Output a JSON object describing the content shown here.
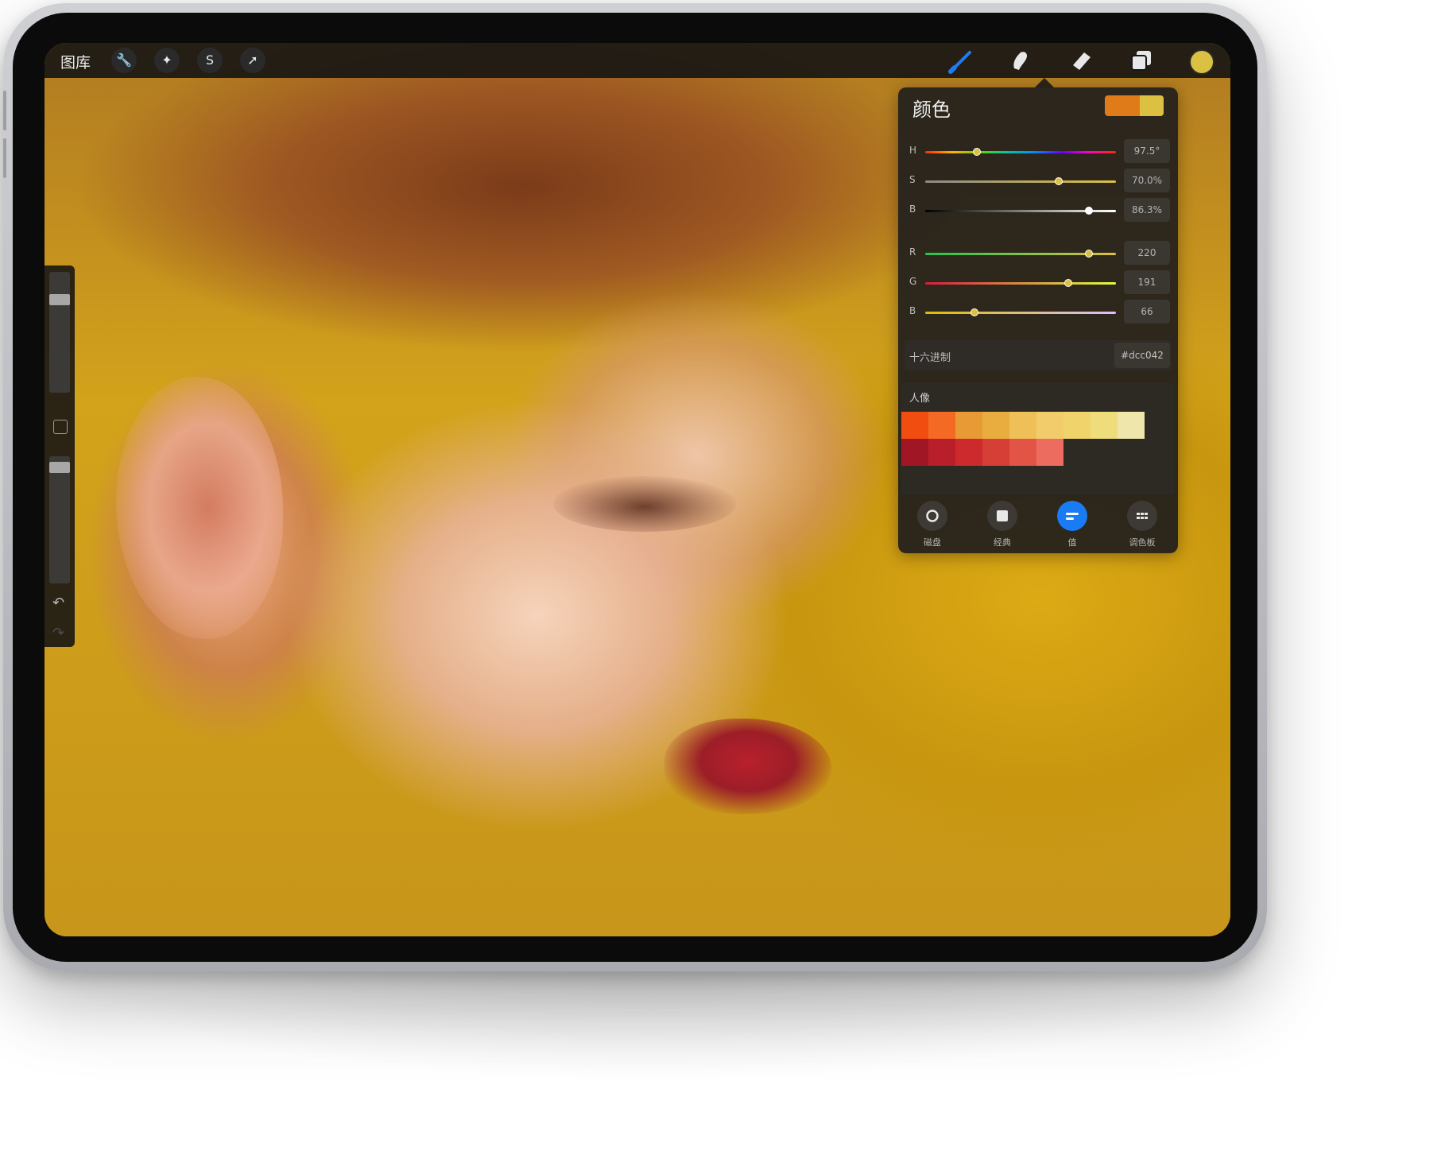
{
  "toolbar": {
    "gallery_label": "图库",
    "left_tools": [
      {
        "name": "actions",
        "icon": "wrench-icon",
        "glyph": "🔧"
      },
      {
        "name": "adjustments",
        "icon": "magic-wand-icon",
        "glyph": "✦"
      },
      {
        "name": "selection",
        "icon": "selection-s-icon",
        "glyph": "S"
      },
      {
        "name": "transform",
        "icon": "arrow-cursor-icon",
        "glyph": "➚"
      }
    ],
    "right_tools": [
      {
        "name": "brush",
        "icon": "brush-icon",
        "color": "#1f7cf0"
      },
      {
        "name": "smudge",
        "icon": "smudge-finger-icon",
        "color": "#e8e8e8"
      },
      {
        "name": "eraser",
        "icon": "eraser-icon",
        "color": "#e8e8e8"
      },
      {
        "name": "layers",
        "icon": "layers-icon",
        "color": "#e8e8e8"
      }
    ],
    "current_color": "#dcc042"
  },
  "sidebar": {
    "size_slider": 0.2,
    "opacity_slider": 0.05,
    "undo_icon": "↶",
    "redo_icon": "↷"
  },
  "color_panel": {
    "title": "颜色",
    "current_swatches": [
      "#e07b1a",
      "#dcc042"
    ],
    "hsb": [
      {
        "label": "H",
        "value": "97.5°",
        "position": 0.27
      },
      {
        "label": "S",
        "value": "70.0%",
        "position": 0.7
      },
      {
        "label": "B",
        "value": "86.3%",
        "position": 0.86
      }
    ],
    "rgb": [
      {
        "label": "R",
        "value": "220",
        "position": 0.86
      },
      {
        "label": "G",
        "value": "191",
        "position": 0.75
      },
      {
        "label": "B",
        "value": "66",
        "position": 0.26
      }
    ],
    "hex_label": "十六进制",
    "hex_value": "#dcc042",
    "palette_label": "人像",
    "palette_rows": [
      [
        "#f24d10",
        "#f46a24",
        "#e89a34",
        "#e8ad3e",
        "#f0c058",
        "#f2cc6a",
        "#f0d36a",
        "#eedd7a",
        "#efe6ab"
      ],
      [
        "#a01624",
        "#b81f2b",
        "#cc2a2c",
        "#d63f36",
        "#e25445",
        "#ec6d60"
      ]
    ],
    "tabs": [
      {
        "label": "磁盘",
        "icon": "disc-icon",
        "active": false
      },
      {
        "label": "经典",
        "icon": "classic-square-icon",
        "active": false
      },
      {
        "label": "值",
        "icon": "value-sliders-icon",
        "active": true
      },
      {
        "label": "调色板",
        "icon": "palette-grid-icon",
        "active": false
      }
    ]
  }
}
